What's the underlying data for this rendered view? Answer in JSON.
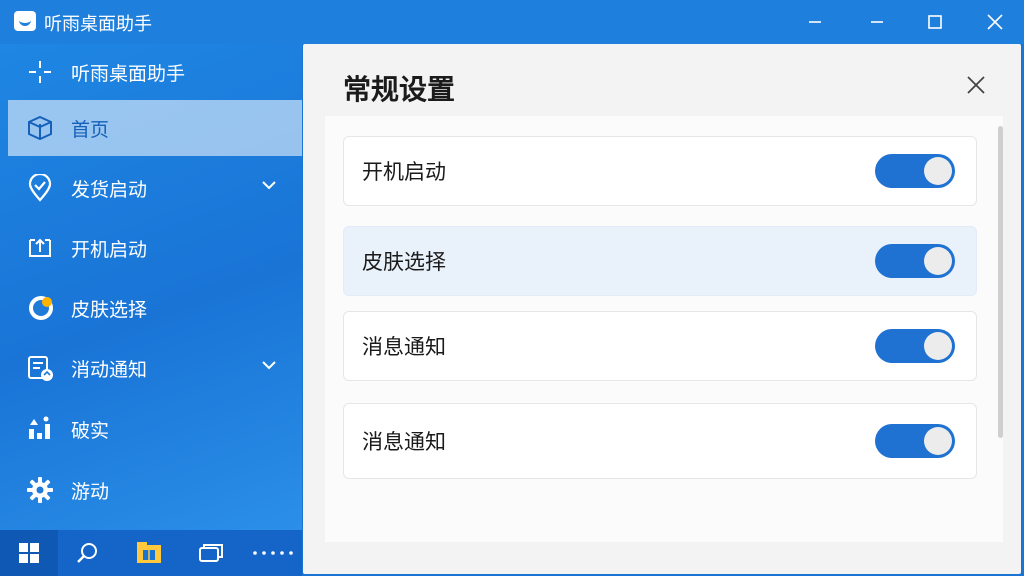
{
  "window": {
    "title": "听雨桌面助手",
    "controls": [
      "minimize",
      "maximize",
      "close"
    ]
  },
  "sidebar": {
    "items": [
      {
        "label": "听雨桌面助手",
        "icon": "crosshair-icon",
        "active": false,
        "has_chevron": false
      },
      {
        "label": "首页",
        "icon": "cube-icon",
        "active": true,
        "has_chevron": false
      },
      {
        "label": "发货启动",
        "icon": "location-check-icon",
        "active": false,
        "has_chevron": true
      },
      {
        "label": "开机启动",
        "icon": "startup-arrow-icon",
        "active": false,
        "has_chevron": false
      },
      {
        "label": "皮肤选择",
        "icon": "theme-moon-icon",
        "active": false,
        "has_chevron": false
      },
      {
        "label": "消动通知",
        "icon": "notification-doc-icon",
        "active": false,
        "has_chevron": true
      },
      {
        "label": "破实",
        "icon": "tools-icon",
        "active": false,
        "has_chevron": false
      },
      {
        "label": "游动",
        "icon": "gear-icon",
        "active": false,
        "has_chevron": false
      }
    ]
  },
  "taskbar": {
    "buttons": [
      "windows-start-icon",
      "search-icon",
      "file-explorer-icon",
      "task-view-icon",
      "more-dots-icon"
    ]
  },
  "panel": {
    "title": "常规设置",
    "rows": [
      {
        "label": "开机启动",
        "on": true
      },
      {
        "label": "皮肤选择",
        "on": true
      },
      {
        "label": "消息通知",
        "on": true
      },
      {
        "label": "消息通知",
        "on": true
      }
    ]
  },
  "colors": {
    "accent": "#1f72d2",
    "sidebar": "#1a74d4",
    "titlebar": "#1e7fdc",
    "panel_bg": "#f3f3f3"
  }
}
